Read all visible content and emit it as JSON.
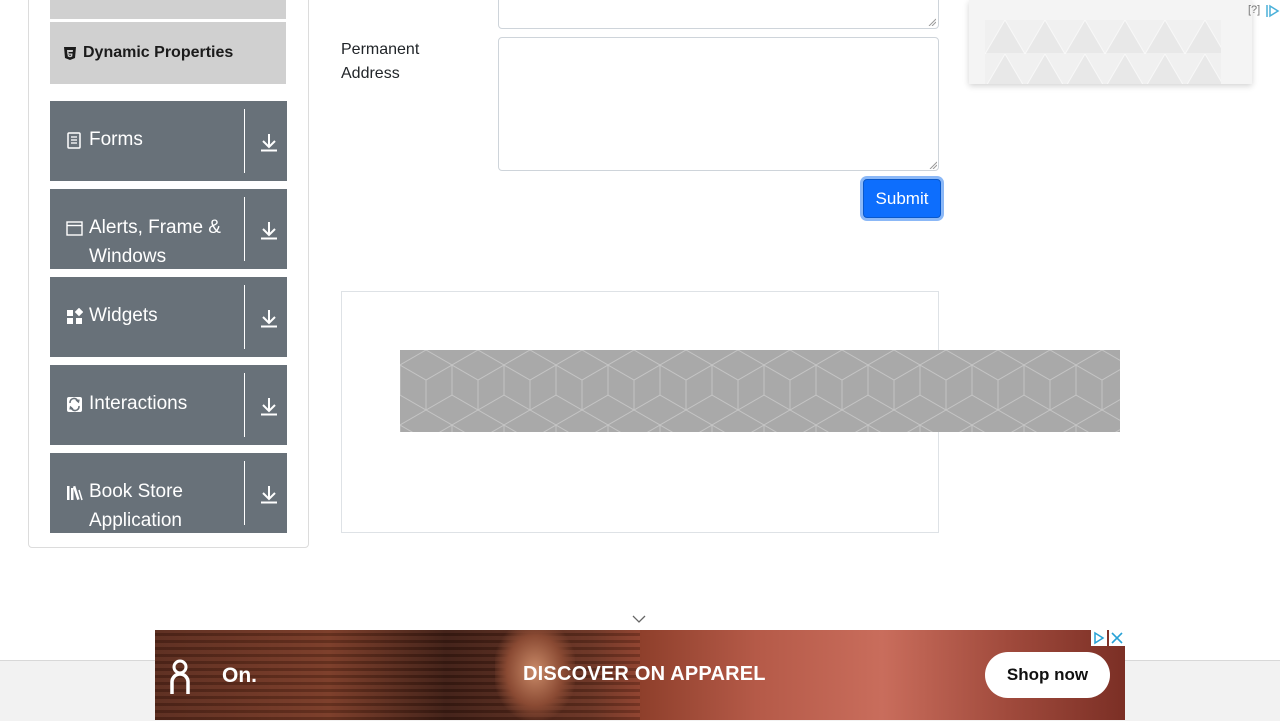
{
  "sidebar": {
    "active_item": "Dynamic Properties",
    "groups": [
      {
        "label": "Forms",
        "icon": "form-icon"
      },
      {
        "label": "Alerts, Frame & Windows",
        "icon": "window-icon"
      },
      {
        "label": "Widgets",
        "icon": "widgets-icon"
      },
      {
        "label": "Interactions",
        "icon": "interactions-icon"
      },
      {
        "label": "Book Store Application",
        "icon": "book-icon"
      }
    ]
  },
  "form": {
    "permanent_address_label": "Permanent Address",
    "permanent_address_value": "",
    "submit_label": "Submit"
  },
  "right_ad": {
    "ad_choices_text": "[?]"
  },
  "bottom_ad": {
    "brand": "On.",
    "headline": "DISCOVER ON APPAREL",
    "cta": "Shop now"
  },
  "colors": {
    "sidebar_group_bg": "#687179",
    "sidebar_active_bg": "#d0d0d0",
    "submit_bg": "#0d6efd",
    "banner_gray": "#a9a9a9"
  }
}
